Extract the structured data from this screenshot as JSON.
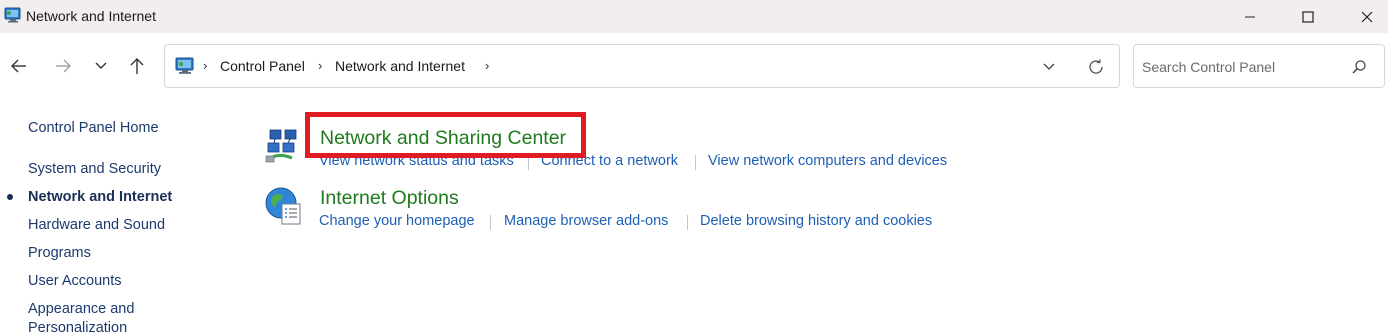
{
  "window": {
    "title": "Network and Internet"
  },
  "navigation": {
    "breadcrumbs": [
      "Control Panel",
      "Network and Internet"
    ],
    "search_placeholder": "Search Control Panel"
  },
  "sidebar": {
    "home_label": "Control Panel Home",
    "items": [
      {
        "label": "System and Security",
        "current": false
      },
      {
        "label": "Network and Internet",
        "current": true
      },
      {
        "label": "Hardware and Sound",
        "current": false
      },
      {
        "label": "Programs",
        "current": false
      },
      {
        "label": "User Accounts",
        "current": false
      },
      {
        "label": "Appearance and",
        "current": false
      },
      {
        "label": "Personalization",
        "current": false
      }
    ]
  },
  "categories": [
    {
      "title": "Network and Sharing Center",
      "icon": "network-sharing-icon",
      "tasks": [
        "View network status and tasks",
        "Connect to a network",
        "View network computers and devices"
      ]
    },
    {
      "title": "Internet Options",
      "icon": "internet-options-icon",
      "tasks": [
        "Change your homepage",
        "Manage browser add-ons",
        "Delete browsing history and cookies"
      ]
    }
  ],
  "colors": {
    "category_title": "#1e7a1e",
    "task_link": "#1f5fb4",
    "sidebar_link": "#1c3a6b",
    "highlight": "#e01b24",
    "titlebar_bg": "#f3eeee"
  }
}
